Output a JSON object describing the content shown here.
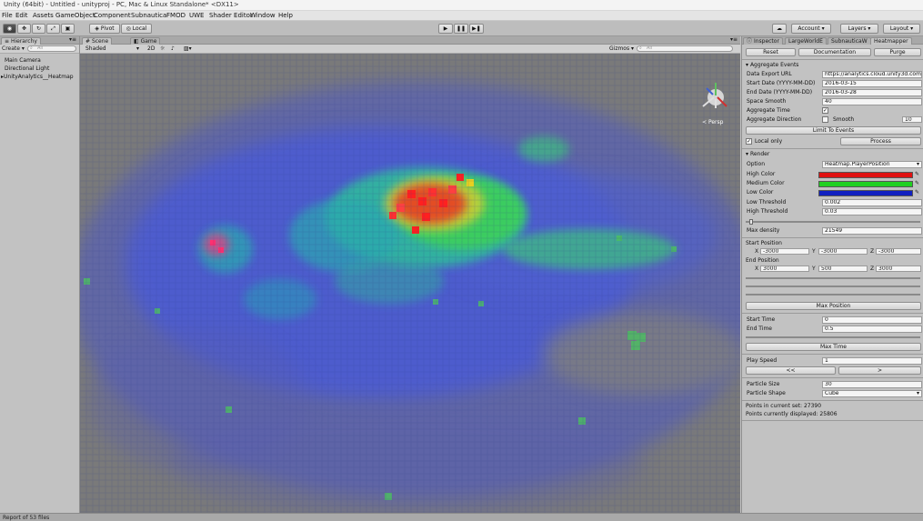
{
  "window": {
    "title": "Unity (64bit) - Untitled - unityproj - PC, Mac & Linux Standalone* <DX11>"
  },
  "menu": [
    "File",
    "Edit",
    "Assets",
    "GameObject",
    "Component",
    "Subnautica",
    "FMOD",
    "UWE",
    "Shader Editor",
    "Window",
    "Help"
  ],
  "toolbar": {
    "pivot_label": "Pivot",
    "local_label": "Local",
    "account_label": "Account",
    "layers_label": "Layers",
    "layout_label": "Layout"
  },
  "hierarchy": {
    "tab_label": "Hierarchy",
    "create_label": "Create",
    "search_placeholder": "All",
    "items": [
      "Main Camera",
      "Directional Light",
      "UnityAnalytics__Heatmap"
    ]
  },
  "scene": {
    "tab_scene": "Scene",
    "tab_game": "Game",
    "shading": "Shaded",
    "mode_2d": "2D",
    "gizmos_label": "Gizmos",
    "search_placeholder": "All",
    "persp_label": "Persp"
  },
  "inspector": {
    "tabs": [
      "Inspector",
      "LargeWorldE",
      "SubnauticaW",
      "Heatmapper"
    ],
    "buttons": {
      "reset": "Reset",
      "documentation": "Documentation",
      "purge": "Purge"
    },
    "aggregate": {
      "header": "Aggregate Events",
      "data_export_url_label": "Data Export URL",
      "data_export_url": "https://analytics.cloud.unity3d.com/api",
      "start_date_label": "Start Date (YYYY-MM-DD)",
      "start_date": "2016-03-15",
      "end_date_label": "End Date (YYYY-MM-DD)",
      "end_date": "2016-03-28",
      "space_smooth_label": "Space Smooth",
      "space_smooth": "40",
      "aggregate_time_label": "Aggregate Time",
      "aggregate_direction_label": "Aggregate Direction",
      "smooth_label": "Smooth",
      "smooth_value": "10",
      "limit_label": "Limit To Events",
      "local_only_label": "Local only",
      "process_label": "Process"
    },
    "render": {
      "header": "Render",
      "option_label": "Option",
      "option_value": "Heatmap.PlayerPosition",
      "high_color_label": "High Color",
      "medium_color_label": "Medium Color",
      "low_color_label": "Low Color",
      "high_color": "#e01010",
      "medium_color": "#20d020",
      "low_color": "#1020c0",
      "low_threshold_label": "Low Threshold",
      "low_threshold": "0.002",
      "high_threshold_label": "High Threshold",
      "high_threshold": "0.03",
      "max_density_label": "Max density",
      "max_density": "21549",
      "start_position_label": "Start Position",
      "start_x": "-3000",
      "start_y": "-3000",
      "start_z": "-3000",
      "end_position_label": "End Position",
      "end_x": "3000",
      "end_y": "500",
      "end_z": "3000",
      "max_position_label": "Max Position",
      "start_time_label": "Start Time",
      "start_time": "0",
      "end_time_label": "End Time",
      "end_time": "0.5",
      "max_time_label": "Max Time",
      "play_speed_label": "Play Speed",
      "play_speed": "1",
      "rewind_label": "<<",
      "play_label": ">",
      "particle_size_label": "Particle Size",
      "particle_size": "30",
      "particle_shape_label": "Particle Shape",
      "particle_shape": "Cube",
      "points_in_set_label": "Points in current set: 27390",
      "points_displayed_label": "Points currently displayed: 25806"
    }
  },
  "status": {
    "text": "Report of 53 files"
  }
}
